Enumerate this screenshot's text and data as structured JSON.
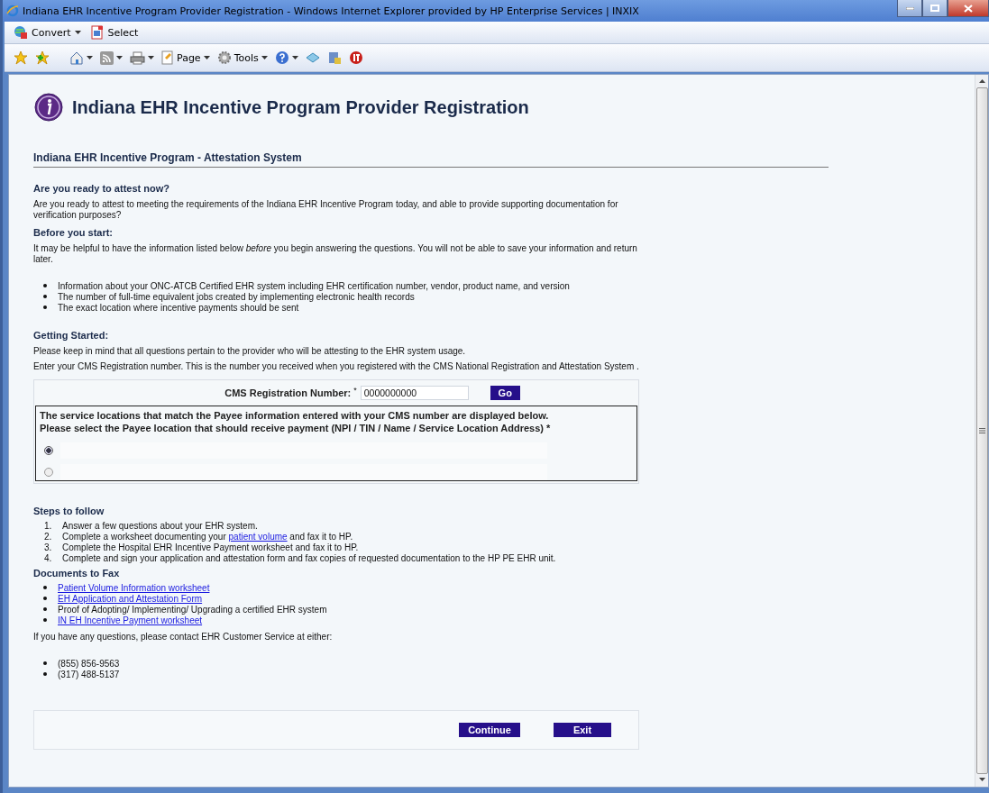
{
  "window": {
    "title": "Indiana EHR Incentive Program Provider Registration - Windows Internet Explorer provided by HP Enterprise Services | INXIX"
  },
  "command_bar": [
    {
      "label": "Convert",
      "dropdown": true
    },
    {
      "label": "Select",
      "dropdown": false
    }
  ],
  "toolbar": {
    "page_label": "Page",
    "tools_label": "Tools"
  },
  "page": {
    "title": "Indiana EHR Incentive Program Provider Registration",
    "section_title": "Indiana EHR Incentive Program - Attestation System",
    "ready_heading": "Are you ready to attest now?",
    "ready_text": "Are you ready to attest to meeting the requirements of the Indiana EHR Incentive Program today, and able to provide supporting documentation for verification purposes?",
    "before_heading": "Before you start:",
    "before_text": "It may be helpful to have the information listed below *before* you begin answering the questions. You will not be able to save your information and return later.",
    "before_items": [
      "Information about your ONC-ATCB Certified EHR system including EHR certification number, vendor, product name, and version",
      "The number of full-time equivalent jobs created by implementing electronic health records",
      "The exact location where incentive payments should be sent"
    ],
    "started_heading": "Getting Started:",
    "started_texts": [
      "Please keep in mind that all questions pertain to the provider who will be attesting to the EHR system usage.",
      "Enter your CMS Registration number. This is the number you received when you registered with the CMS National Registration and Attestation System ."
    ],
    "cms_label": "CMS Registration Number:",
    "cms_required": "*",
    "cms_value": "0000000000",
    "go_button": "Go",
    "payee_texts": [
      "The service locations that match the Payee information entered with your CMS number are displayed below.",
      "Please select the Payee location that should receive payment (NPI / TIN / Name / Service Location Address) *"
    ],
    "payee_options": [
      {
        "selected": true
      },
      {
        "selected": false
      }
    ],
    "steps_heading": "Steps to follow",
    "steps": [
      {
        "number": "1.",
        "text": "Answer a few questions about your EHR system."
      },
      {
        "number": "2.",
        "text": "Complete a worksheet documenting your ",
        "link": "patient volume",
        "after": " and fax it to HP."
      },
      {
        "number": "3.",
        "text": "Complete the Hospital EHR Incentive Payment worksheet and fax it to HP."
      },
      {
        "number": "4.",
        "text": "Complete and sign your application and attestation form and fax copies of requested documentation to the HP PE EHR unit."
      }
    ],
    "documents_heading": "Documents to Fax",
    "documents": [
      {
        "text": "Patient Volume Information worksheet",
        "link": true
      },
      {
        "text": "EH Application and Attestation Form",
        "link": true
      },
      {
        "text": "Proof of Adopting/ Implementing/ Upgrading a certified EHR system",
        "link": false
      },
      {
        "text": "IN EH Incentive Payment worksheet",
        "link": true
      }
    ],
    "contact_text": "If you have any questions, please contact EHR Customer Service at either:",
    "phones": [
      "(855) 856-9563",
      "(317) 488-5137"
    ],
    "buttons": [
      "Continue",
      "Exit"
    ]
  }
}
